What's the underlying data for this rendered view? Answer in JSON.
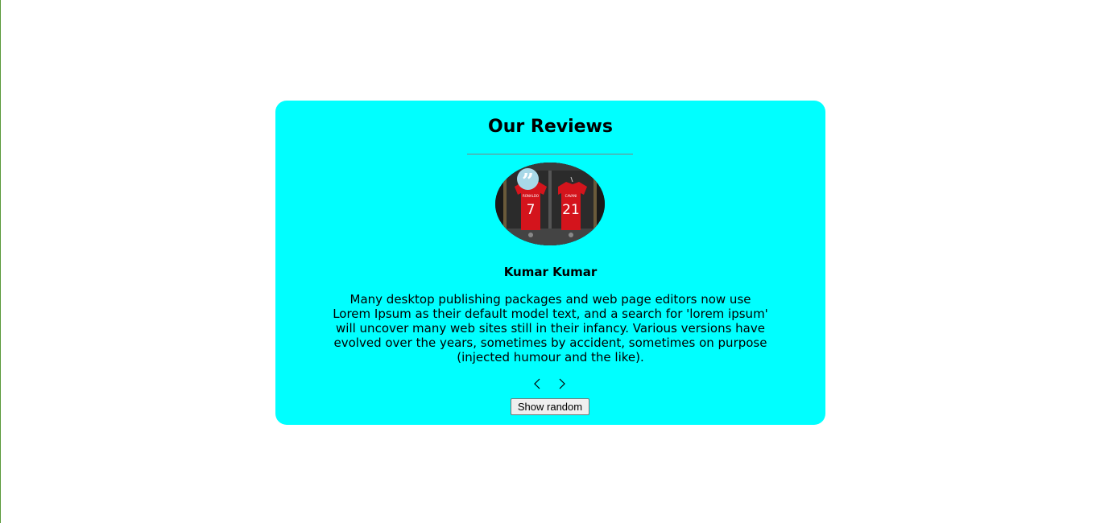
{
  "section": {
    "title": "Our Reviews"
  },
  "review": {
    "name": "Kumar Kumar",
    "text": "Many desktop publishing packages and web page editors now use Lorem Ipsum as their default model text, and a search for 'lorem ipsum' will uncover many web sites still in their infancy. Various versions have evolved over the years, sometimes by accident, sometimes on purpose (injected humour and the like).",
    "image_alt": "two red football jerseys numbered 7 and 21 hanging in a locker room"
  },
  "icons": {
    "quote": "quote-icon",
    "prev": "chevron-left-icon",
    "next": "chevron-right-icon"
  },
  "controls": {
    "random_label": "Show random"
  },
  "colors": {
    "card_background": "#00ffff",
    "quote_badge": "#a8d8e8",
    "jersey_red": "#d4141c"
  }
}
